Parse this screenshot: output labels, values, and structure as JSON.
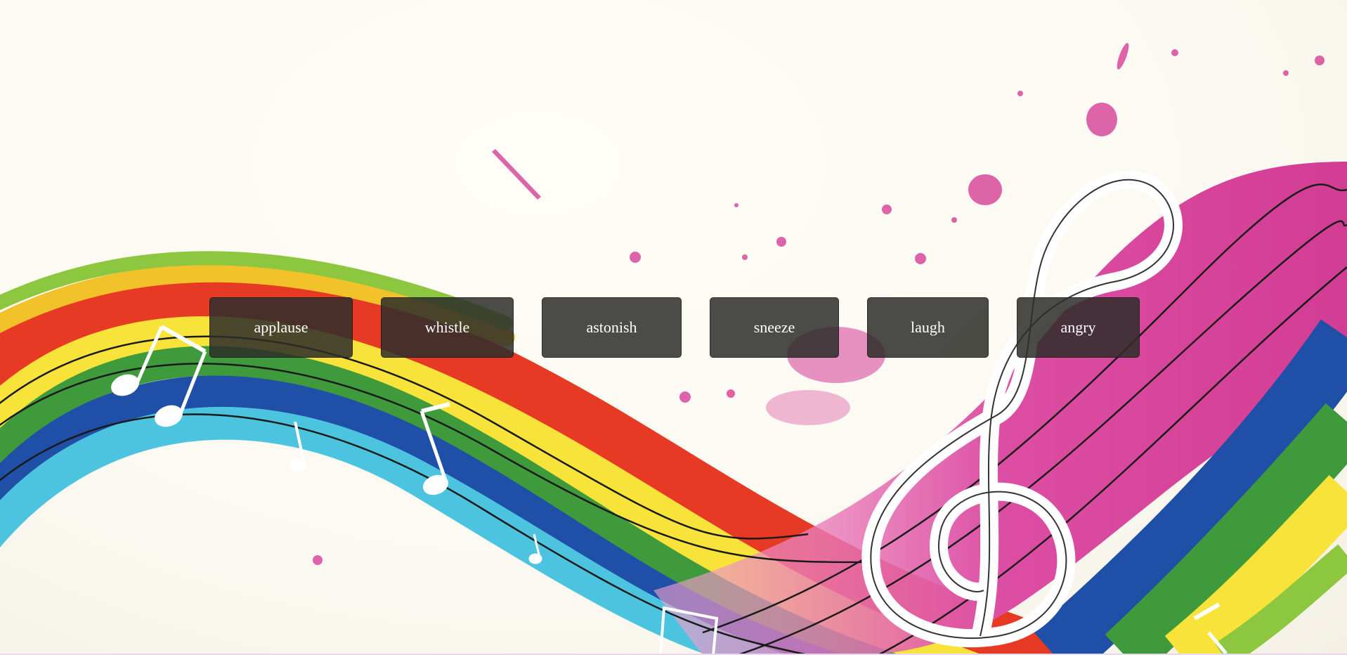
{
  "page": {
    "background_color": "#fdfbf4",
    "background_art": "rainbow-music-wave-with-treble-clef-and-notes"
  },
  "buttons": [
    {
      "label": "applause"
    },
    {
      "label": "whistle"
    },
    {
      "label": "astonish"
    },
    {
      "label": "sneeze"
    },
    {
      "label": "laugh"
    },
    {
      "label": "angry"
    }
  ],
  "colors": {
    "button_bg": "#3a3a37",
    "button_text": "#ffffff",
    "magenta": "#d9489c",
    "red": "#e63a24",
    "yellow": "#f7e33a",
    "green": "#3f9a3c",
    "blue": "#1f4fa6",
    "cyan": "#4cc4e0"
  }
}
